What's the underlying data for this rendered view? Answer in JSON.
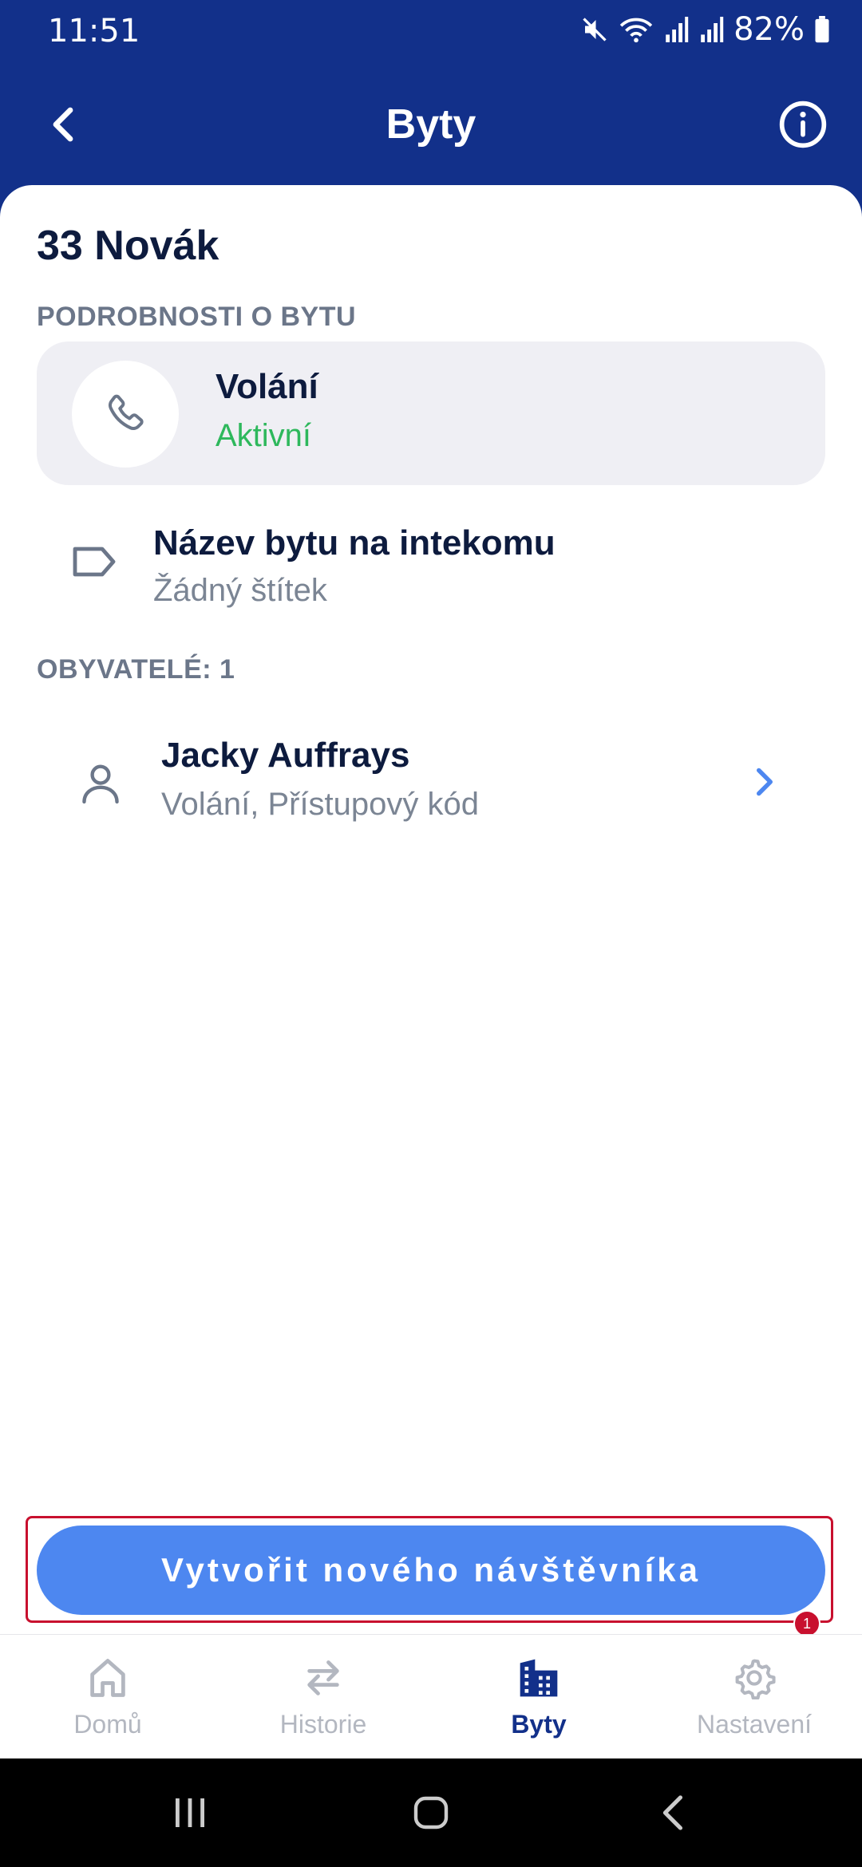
{
  "status_bar": {
    "time": "11:51",
    "battery": "82%"
  },
  "header": {
    "title": "Byty",
    "back_icon": "chevron-left-icon",
    "info_icon": "info-circle-icon"
  },
  "apartment": {
    "name": "33 Novák",
    "details_label": "PODROBNOSTI O BYTU",
    "call": {
      "title": "Volání",
      "status": "Aktivní",
      "icon": "phone-icon"
    },
    "intercom_label": {
      "title": "Název bytu na intekomu",
      "value": "Žádný štítek",
      "icon": "tag-icon"
    }
  },
  "residents": {
    "label": "OBYVATELÉ: 1",
    "items": [
      {
        "name": "Jacky Auffrays",
        "detail": "Volání, Přístupový kód",
        "icon": "person-icon"
      }
    ]
  },
  "create_button": {
    "label": "Vytvořit nového návštěvníka",
    "badge": "1"
  },
  "bottom_nav": {
    "items": [
      {
        "label": "Domů",
        "icon": "home-icon",
        "active": false
      },
      {
        "label": "Historie",
        "icon": "arrows-swap-icon",
        "active": false
      },
      {
        "label": "Byty",
        "icon": "building-icon",
        "active": true
      },
      {
        "label": "Nastavení",
        "icon": "gear-icon",
        "active": false
      }
    ]
  },
  "colors": {
    "brand": "#12308a",
    "accent": "#4d87f0",
    "active_status": "#2eb85c",
    "highlight": "#c8102e"
  }
}
